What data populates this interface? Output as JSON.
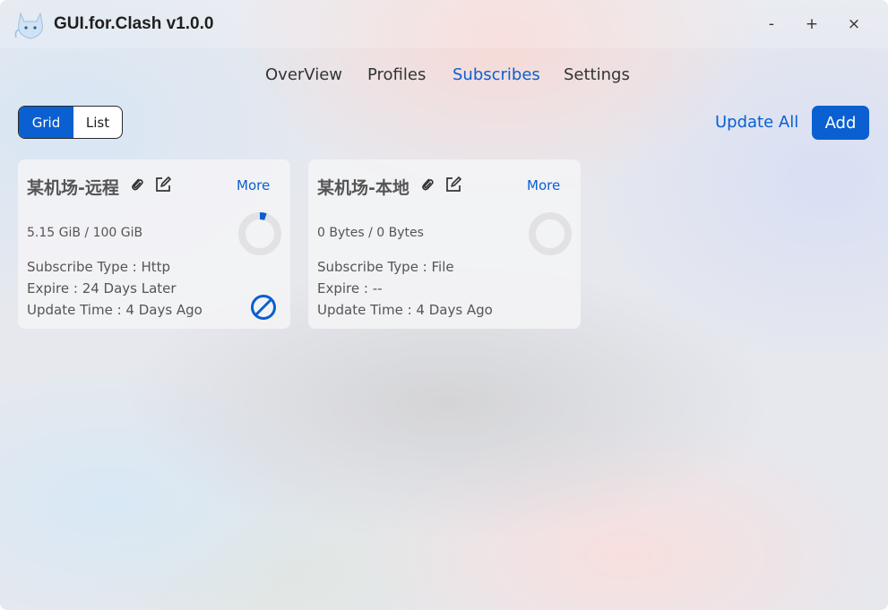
{
  "app": {
    "title": "GUI.for.Clash v1.0.0",
    "logo_icon": "cat-logo-icon"
  },
  "window_controls": {
    "minimize": "-",
    "maximize": "+",
    "close": "×"
  },
  "nav": {
    "tabs": [
      {
        "label": "OverView",
        "active": false
      },
      {
        "label": "Profiles",
        "active": false
      },
      {
        "label": "Subscribes",
        "active": true
      },
      {
        "label": "Settings",
        "active": false
      }
    ]
  },
  "toolbar": {
    "view_toggle": [
      {
        "label": "Grid",
        "active": true
      },
      {
        "label": "List",
        "active": false
      }
    ],
    "update_all_label": "Update All",
    "add_label": "Add"
  },
  "subscriptions": [
    {
      "name": "某机场-远程",
      "more_label": "More",
      "usage": "5.15 GiB / 100 GiB",
      "usage_fraction": 0.0515,
      "subscribe_type": "Subscribe Type : Http",
      "expire": "Expire : 24 Days Later",
      "update_time": "Update Time : 4 Days Ago",
      "icons": [
        "link-icon",
        "edit-icon",
        "disable-icon"
      ]
    },
    {
      "name": "某机场-本地",
      "more_label": "More",
      "usage": "0 Bytes / 0 Bytes",
      "usage_fraction": 0,
      "subscribe_type": "Subscribe Type : File",
      "expire": "Expire : --",
      "update_time": "Update Time : 4 Days Ago",
      "icons": [
        "link-icon",
        "edit-icon"
      ]
    }
  ],
  "colors": {
    "accent": "#0a5fd1",
    "donut_track": "#e2e2e4"
  }
}
